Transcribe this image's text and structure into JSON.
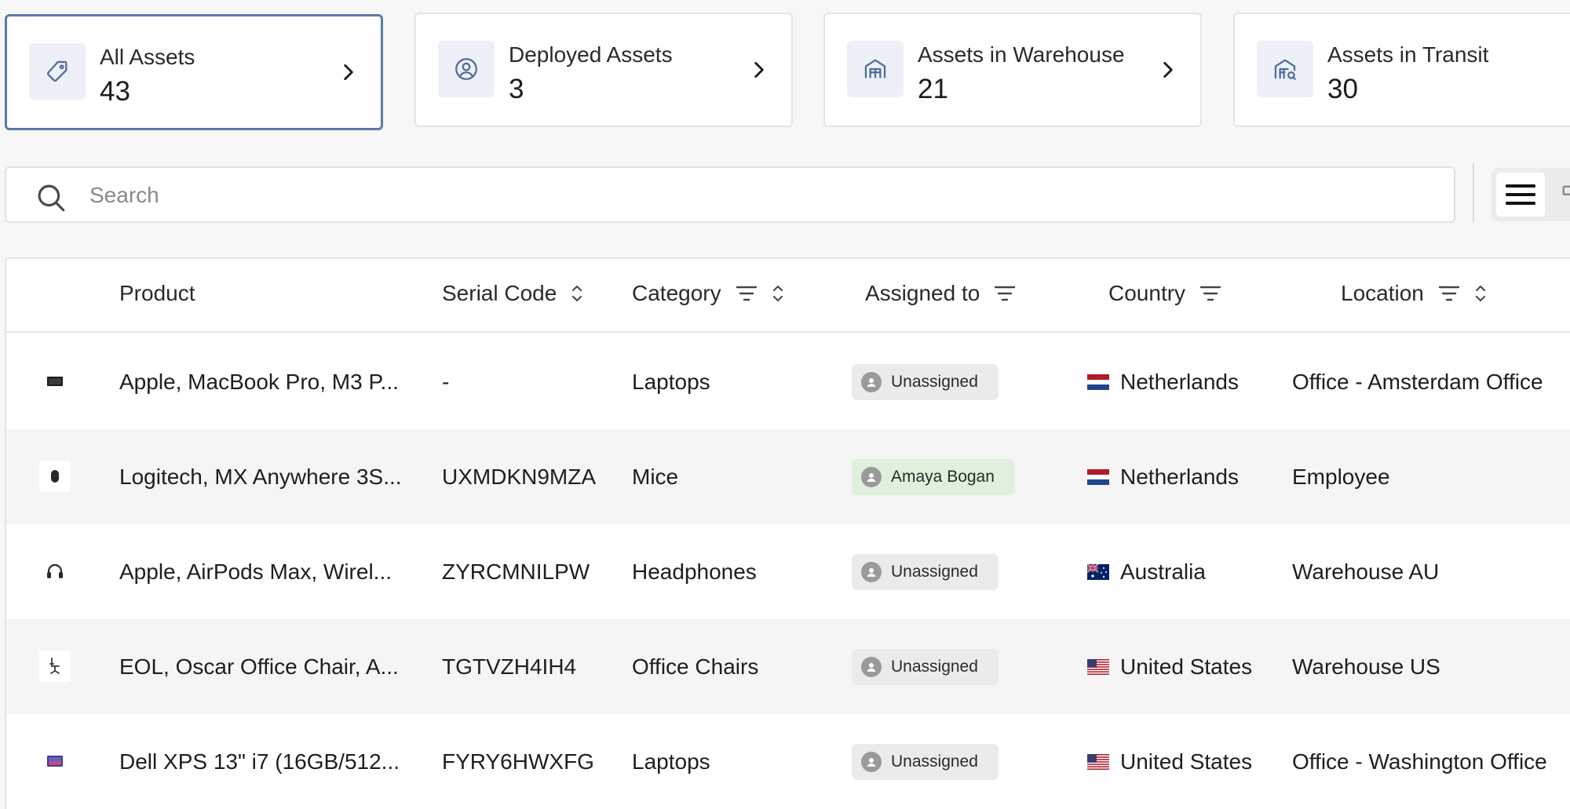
{
  "cards": [
    {
      "label": "All Assets",
      "value": "43",
      "icon": "tag-icon",
      "active": true
    },
    {
      "label": "Deployed Assets",
      "value": "3",
      "icon": "user-circle-icon",
      "active": false
    },
    {
      "label": "Assets in Warehouse",
      "value": "21",
      "icon": "warehouse-icon",
      "active": false
    },
    {
      "label": "Assets in Transit",
      "value": "30",
      "icon": "warehouse-transit-icon",
      "active": false
    }
  ],
  "search": {
    "placeholder": "Search",
    "value": ""
  },
  "table": {
    "headers": {
      "product": "Product",
      "serial": "Serial Code",
      "category": "Category",
      "assigned": "Assigned to",
      "country": "Country",
      "location": "Location"
    },
    "rows": [
      {
        "product": "Apple, MacBook Pro, M3 P...",
        "serial": "-",
        "category": "Laptops",
        "assigned": "Unassigned",
        "assigned_state": "unassigned",
        "country": "Netherlands",
        "flag": "nl",
        "location": "Office - Amsterdam Office",
        "thumb": "laptop"
      },
      {
        "product": "Logitech, MX Anywhere 3S...",
        "serial": "UXMDKN9MZA",
        "category": "Mice",
        "assigned": "Amaya Bogan",
        "assigned_state": "assigned",
        "country": "Netherlands",
        "flag": "nl",
        "location": "Employee",
        "thumb": "mouse"
      },
      {
        "product": "Apple, AirPods Max, Wirel...",
        "serial": "ZYRCMNILPW",
        "category": "Headphones",
        "assigned": "Unassigned",
        "assigned_state": "unassigned",
        "country": "Australia",
        "flag": "au",
        "location": "Warehouse AU",
        "thumb": "headphones"
      },
      {
        "product": "EOL, Oscar Office Chair, A...",
        "serial": "TGTVZH4IH4",
        "category": "Office Chairs",
        "assigned": "Unassigned",
        "assigned_state": "unassigned",
        "country": "United States",
        "flag": "us",
        "location": "Warehouse US",
        "thumb": "chair"
      },
      {
        "product": "Dell XPS 13\" i7 (16GB/512...",
        "serial": "FYRY6HWXFG",
        "category": "Laptops",
        "assigned": "Unassigned",
        "assigned_state": "unassigned",
        "country": "United States",
        "flag": "us",
        "location": "Office - Washington Office",
        "thumb": "laptop-color"
      }
    ]
  },
  "colors": {
    "active_border": "#5b7aa8",
    "icon_bg": "#edf0f7",
    "icon_stroke": "#4f6d9a",
    "chip_unassigned": "#ebebeb",
    "chip_assigned": "#dff1dd"
  }
}
